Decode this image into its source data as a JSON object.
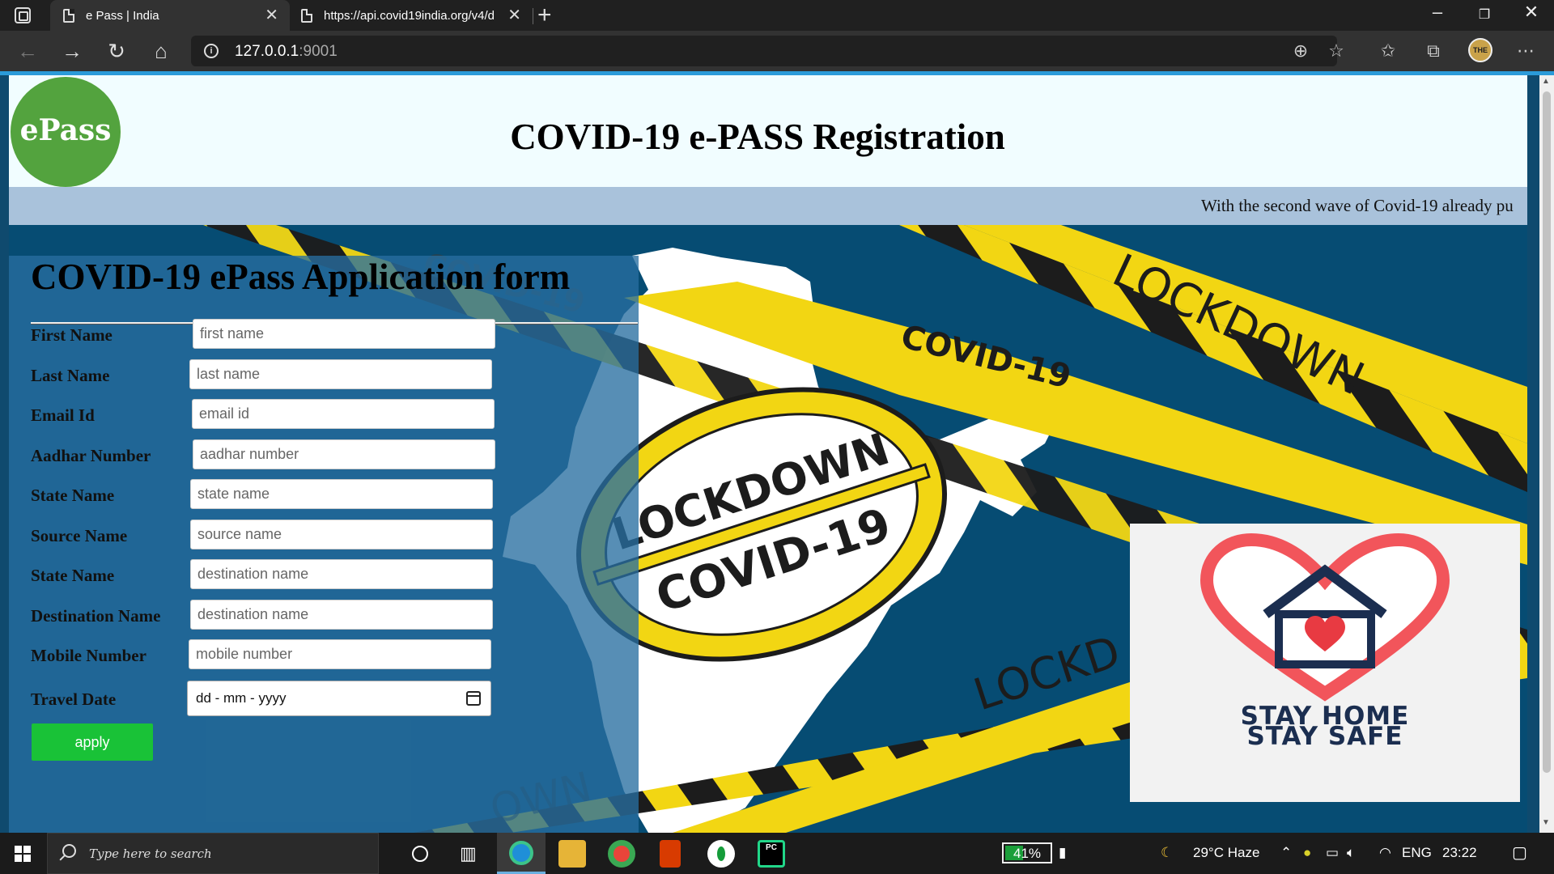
{
  "browser": {
    "tabs": [
      {
        "title": "e Pass | India",
        "active": true
      },
      {
        "title": "https://api.covid19india.org/v4/d",
        "active": false
      }
    ],
    "address": {
      "host": "127.0.0.1",
      "port": ":9001"
    },
    "profile_badge": "THE"
  },
  "header": {
    "logo_text": "ePass",
    "title": "COVID-19 e-PASS Registration"
  },
  "marquee": "With the second wave of Covid-19 already pu",
  "hero": {
    "tape_texts": [
      "COVID-19",
      "LOCKDOWN",
      "COVID-19",
      "LOCKD",
      "OWN"
    ],
    "seal_texts": [
      "LOCKDOWN",
      "COVID-19"
    ]
  },
  "form": {
    "heading": "COVID-19 ePass Application form",
    "fields": [
      {
        "label": "First Name",
        "placeholder": "first name"
      },
      {
        "label": "Last Name",
        "placeholder": "last name"
      },
      {
        "label": "Email Id",
        "placeholder": "email id"
      },
      {
        "label": "Aadhar Number",
        "placeholder": "aadhar number"
      },
      {
        "label": "State Name",
        "placeholder": "state name"
      },
      {
        "label": "Source Name",
        "placeholder": "source name"
      },
      {
        "label": "State Name",
        "placeholder": "destination name"
      },
      {
        "label": "Destination Name",
        "placeholder": "destination name"
      },
      {
        "label": "Mobile Number",
        "placeholder": "mobile number"
      }
    ],
    "travel_date": {
      "label": "Travel Date",
      "value": "dd - mm - yyyy"
    },
    "apply_label": "apply"
  },
  "stay_card": {
    "line1": "STAY HOME",
    "line2": "STAY SAFE"
  },
  "taskbar": {
    "search_placeholder": "Type here to search",
    "battery": "41%",
    "battery_level": 0.41,
    "weather": "29°C  Haze",
    "language": "ENG",
    "time": "23:22"
  },
  "colors": {
    "hero_bg": "#064c73",
    "tape_yellow": "#f2d613",
    "apply_green": "#19c237",
    "logo_green": "#53a33e"
  }
}
